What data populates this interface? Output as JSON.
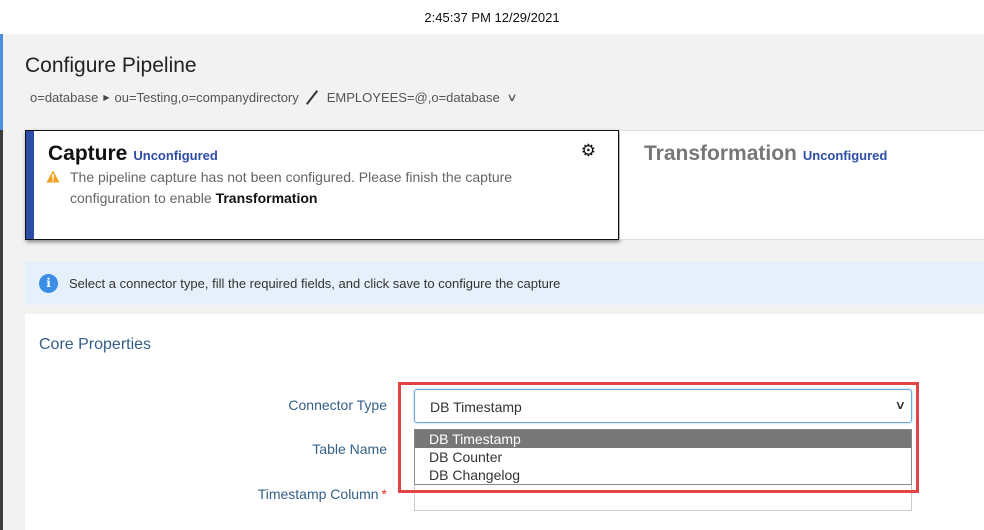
{
  "clock": "2:45:37 PM 12/29/2021",
  "page_title": "Configure Pipeline",
  "breadcrumb": {
    "part1": "o=database",
    "part2": "ou=Testing,o=companydirectory",
    "part3": "EMPLOYEES=@,o=database"
  },
  "capture_card": {
    "title": "Capture",
    "status": "Unconfigured",
    "message": "The pipeline capture has not been configured. Please finish the capture configuration to enable",
    "message_bold": "Transformation"
  },
  "transformation_card": {
    "title": "Transformation",
    "status": "Unconfigured"
  },
  "info_message": "Select a connector type, fill the required fields, and click save to configure the capture",
  "core_properties": {
    "title": "Core Properties",
    "connector_type_label": "Connector Type",
    "table_name_label": "Table Name",
    "timestamp_column_label": "Timestamp Column",
    "required_marker": "*",
    "connector_type_value": "DB Timestamp",
    "options": [
      "DB Timestamp",
      "DB Counter",
      "DB Changelog"
    ]
  },
  "colors": {
    "accent": "#2d4ea8",
    "status": "#2d4ea8",
    "label": "#345f88",
    "highlight": "#e04444",
    "info_bg": "#e6f0fb"
  },
  "icons": [
    "caret-right-icon",
    "chevron-down-icon",
    "gear-icon",
    "warning-icon",
    "info-icon"
  ]
}
